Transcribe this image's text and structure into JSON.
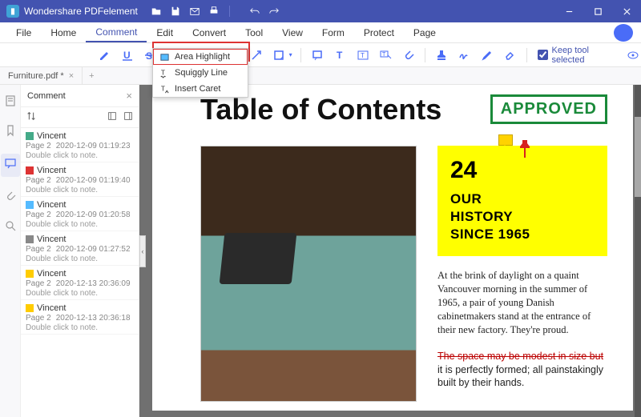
{
  "app": {
    "title": "Wondershare PDFelement"
  },
  "menu": {
    "file": "File",
    "home": "Home",
    "comment": "Comment",
    "edit": "Edit",
    "convert": "Convert",
    "tool": "Tool",
    "view": "View",
    "form": "Form",
    "protect": "Protect",
    "page": "Page"
  },
  "toolbar": {
    "keep_tool": "Keep tool selected"
  },
  "tab": {
    "name": "Furniture.pdf *"
  },
  "sidebar": {
    "title": "Comment",
    "note_hint": "Double click to note.",
    "entries": [
      {
        "user": "Vincent",
        "page": "Page 2",
        "ts": "2020-12-09 01:19:23",
        "color": "#4a8"
      },
      {
        "user": "Vincent",
        "page": "Page 2",
        "ts": "2020-12-09 01:19:40",
        "color": "#d33"
      },
      {
        "user": "Vincent",
        "page": "Page 2",
        "ts": "2020-12-09 01:20:58",
        "color": "#5bf"
      },
      {
        "user": "Vincent",
        "page": "Page 2",
        "ts": "2020-12-09 01:27:52",
        "color": "#888"
      },
      {
        "user": "Vincent",
        "page": "Page 2",
        "ts": "2020-12-13 20:36:09",
        "color": "#fc0"
      },
      {
        "user": "Vincent",
        "page": "Page 2",
        "ts": "2020-12-13 20:36:18",
        "color": "#fc0"
      }
    ]
  },
  "dropdown": {
    "area_highlight": "Area Highlight",
    "squiggly": "Squiggly Line",
    "insert_caret": "Insert Caret"
  },
  "doc": {
    "heading": "Table of Contents",
    "stamp": "APPROVED",
    "sticky": {
      "number": "24",
      "line1": "OUR",
      "line2": "HISTORY",
      "line3": "SINCE 1965"
    },
    "p1": "At the brink of daylight on a quaint Vancouver morning in the summer of 1965, a pair of young Danish cabinetmakers stand at the entrance of their new factory. They're proud.",
    "p2a": "The space may be modest in size but",
    "p2b": " it is perfectly formed; all painstakingly built by their hands."
  }
}
